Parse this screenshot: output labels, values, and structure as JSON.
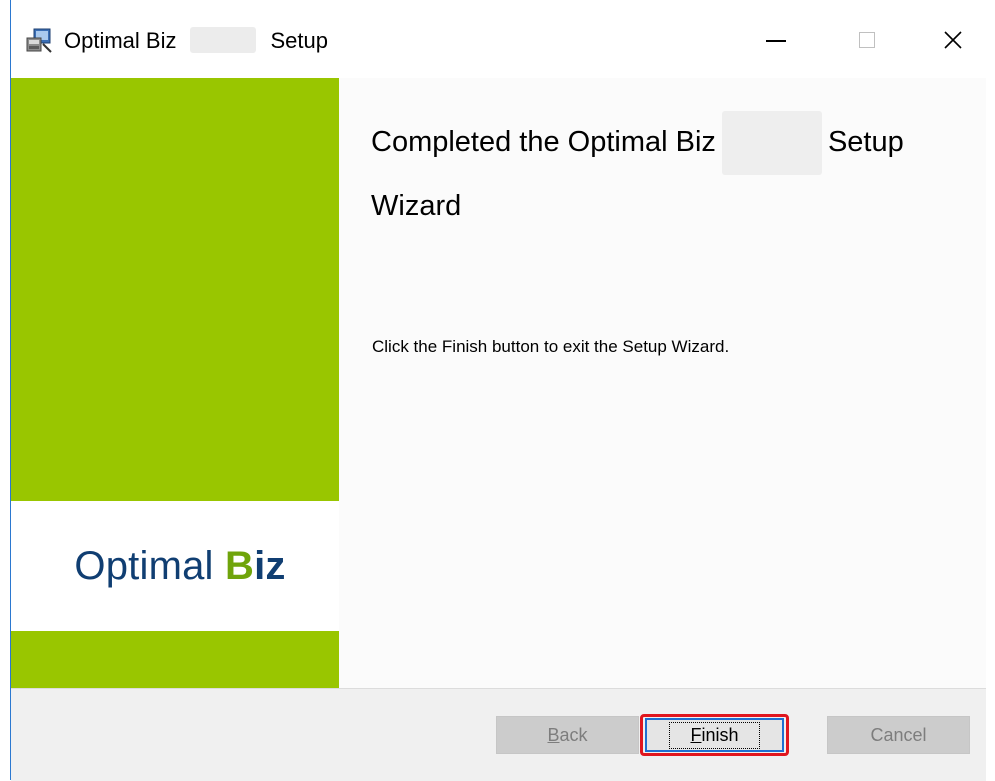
{
  "window": {
    "title_prefix": "Optimal Biz",
    "title_suffix": "Setup",
    "controls": {
      "minimize": "minimize",
      "maximize": "maximize",
      "close": "×"
    }
  },
  "banner": {
    "logo_word1": "Optimal",
    "logo_b": "B",
    "logo_iz": "iz",
    "colors": {
      "green": "#99c600",
      "logo_blue": "#103e72",
      "logo_green": "#6fa40b"
    }
  },
  "main": {
    "heading_prefix": "Completed the Optimal Biz",
    "heading_suffix": "Setup",
    "heading_line2": "Wizard",
    "description": "Click the Finish button to exit the Setup Wizard."
  },
  "footer": {
    "back_first": "B",
    "back_rest": "ack",
    "finish_first": "F",
    "finish_rest": "inish",
    "cancel_label": "Cancel"
  }
}
